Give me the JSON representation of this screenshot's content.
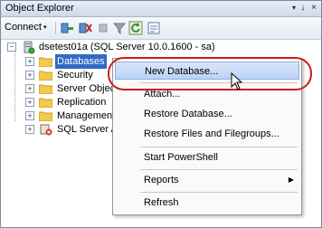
{
  "window": {
    "title": "Object Explorer",
    "pin": "↓",
    "close": "×"
  },
  "toolbar": {
    "connect_label": "Connect",
    "connect_arrow": "▾"
  },
  "tree": {
    "root": {
      "label": "dsetest01a (SQL Server 10.0.1600 - sa)",
      "expander": "⊟"
    },
    "children": [
      {
        "label": "Databases",
        "expander": "+"
      },
      {
        "label": "Security",
        "expander": "+"
      },
      {
        "label": "Server Objects",
        "expander": "+"
      },
      {
        "label": "Replication",
        "expander": "+"
      },
      {
        "label": "Management",
        "expander": "+"
      },
      {
        "label": "SQL Server Ag",
        "expander": "+"
      }
    ]
  },
  "context_menu": {
    "items": [
      {
        "label": "New Database..."
      },
      {
        "label": "Attach..."
      },
      {
        "label": "Restore Database..."
      },
      {
        "label": "Restore Files and Filegroups..."
      },
      {
        "label": "Start PowerShell"
      },
      {
        "label": "Reports",
        "submenu_arrow": "▶"
      },
      {
        "label": "Refresh"
      }
    ]
  },
  "colors": {
    "selection": "#316ac5",
    "highlight_oval": "#d11a1a",
    "folder": "#f2c94c"
  }
}
